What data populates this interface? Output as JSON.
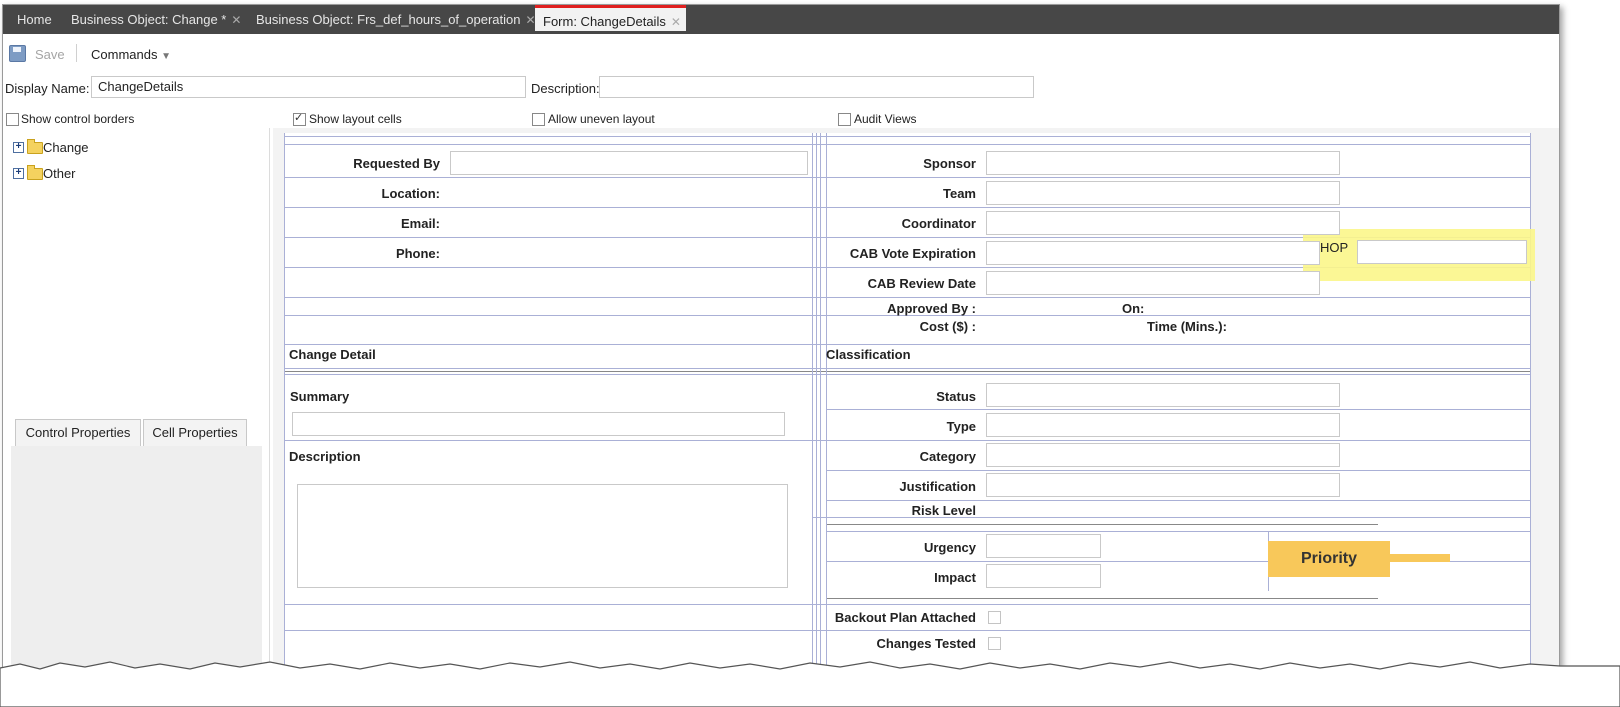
{
  "tabs": [
    {
      "label": "Home",
      "closable": false,
      "active": false
    },
    {
      "label": "Business Object: Change *",
      "closable": true,
      "active": false
    },
    {
      "label": "Business Object: Frs_def_hours_of_operation",
      "closable": true,
      "active": false
    },
    {
      "label": "Form: ChangeDetails",
      "closable": true,
      "active": true
    }
  ],
  "toolbar": {
    "save_label": "Save",
    "commands_label": "Commands"
  },
  "display_name": {
    "label": "Display Name:",
    "value": "ChangeDetails"
  },
  "description": {
    "label": "Description:",
    "value": ""
  },
  "options": {
    "show_control_borders": {
      "label": "Show control borders",
      "checked": false
    },
    "show_layout_cells": {
      "label": "Show layout cells",
      "checked": true
    },
    "allow_uneven_layout": {
      "label": "Allow uneven layout",
      "checked": false
    },
    "audit_views": {
      "label": "Audit Views",
      "checked": false
    }
  },
  "tree": [
    {
      "label": "Change"
    },
    {
      "label": "Other"
    }
  ],
  "property_tabs": {
    "control": "Control Properties",
    "cell": "Cell Properties"
  },
  "form": {
    "requested_by": "Requested By",
    "location": "Location:",
    "email": "Email:",
    "phone": "Phone:",
    "sponsor": "Sponsor",
    "team": "Team",
    "coordinator": "Coordinator",
    "cab_vote_expiration": "CAB Vote Expiration",
    "cab_review_date": "CAB Review Date",
    "approved_by": "Approved By :",
    "on": "On:",
    "cost": "Cost ($) :",
    "time": "Time (Mins.):",
    "change_detail": "Change Detail",
    "classification": "Classification",
    "summary": "Summary",
    "description": "Description",
    "status": "Status",
    "type": "Type",
    "category": "Category",
    "justification": "Justification",
    "risk_level": "Risk Level",
    "urgency": "Urgency",
    "impact": "Impact",
    "backout_plan": "Backout Plan Attached",
    "changes_tested": "Changes Tested",
    "hop": "HOP"
  },
  "callouts": {
    "priority": "Priority"
  },
  "colors": {
    "tabbar": "#474747",
    "active_tab_accent": "#e02020",
    "highlight": "#fbf68a",
    "callout": "#f8c85a",
    "grid_lines": "#aab0d6"
  }
}
